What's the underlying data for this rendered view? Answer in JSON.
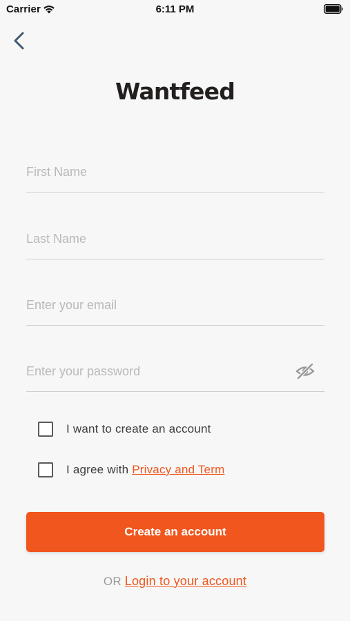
{
  "status_bar": {
    "carrier": "Carrier",
    "time": "6:11 PM"
  },
  "icons": {
    "wifi": "wifi-icon",
    "battery": "battery-icon",
    "back": "chevron-left-icon",
    "eye": "eye-off-icon"
  },
  "logo": "Wantfeed",
  "form": {
    "first_name_placeholder": "First Name",
    "last_name_placeholder": "Last Name",
    "email_placeholder": "Enter your email",
    "password_placeholder": "Enter your password",
    "first_name_value": "",
    "last_name_value": "",
    "email_value": "",
    "password_value": ""
  },
  "checkboxes": {
    "create_account_label": "I want to create an account",
    "agree_prefix": "I agree with ",
    "agree_link": "Privacy and Term",
    "create_account_checked": false,
    "agree_checked": false
  },
  "create_button_label": "Create an account",
  "footer": {
    "or_label": "OR ",
    "login_link": "Login to your account"
  },
  "colors": {
    "accent": "#f0561d",
    "background": "#f7f7f7",
    "placeholder": "#b9b9b9",
    "divider": "#cfcfcf"
  }
}
